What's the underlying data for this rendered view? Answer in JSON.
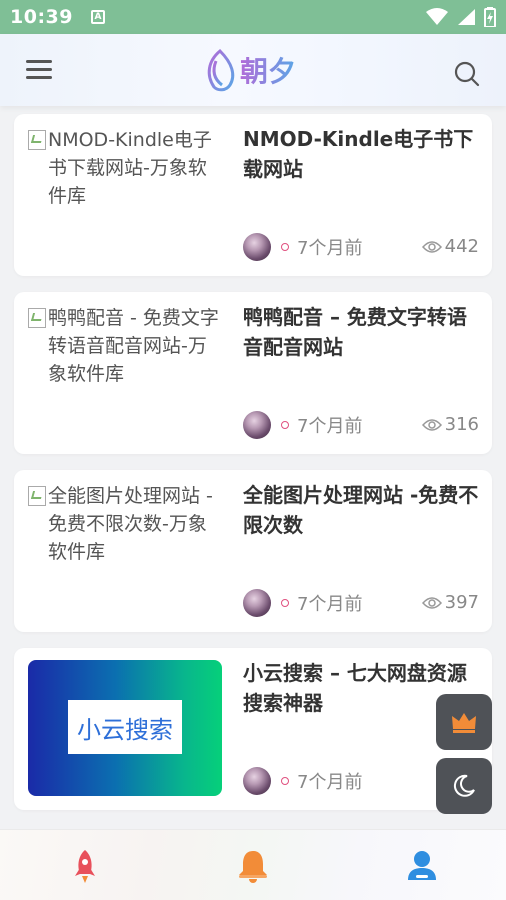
{
  "status_bar": {
    "time": "10:39",
    "notification_letter": "A"
  },
  "header": {
    "logo_text": "朝夕"
  },
  "posts": [
    {
      "thumb_alt": "NMOD-Kindle电子书下载网站-万象软件库",
      "title": "NMOD-Kindle电子书下载网站",
      "time": "7个月前",
      "views": "442"
    },
    {
      "thumb_alt": "鸭鸭配音 - 免费文字转语音配音网站-万象软件库",
      "title": "鸭鸭配音 – 免费文字转语音配音网站",
      "time": "7个月前",
      "views": "316"
    },
    {
      "thumb_alt": "全能图片处理网站 -免费不限次数-万象软件库",
      "title": "全能图片处理网站 -免费不限次数",
      "time": "7个月前",
      "views": "397"
    },
    {
      "thumb_text": "小云搜索",
      "title": "小云搜索 – 七大网盘资源搜索神器",
      "time": "7个月前",
      "views": ""
    }
  ],
  "colors": {
    "status_bar": "#7fbf96",
    "rocket": "#e8505b",
    "bell": "#f28c38",
    "user": "#2f8ee0",
    "crown": "#f28c38"
  },
  "icons": [
    "menu-icon",
    "search-icon",
    "eye-icon",
    "crown-icon",
    "moon-icon",
    "rocket-icon",
    "bell-icon",
    "user-icon"
  ]
}
